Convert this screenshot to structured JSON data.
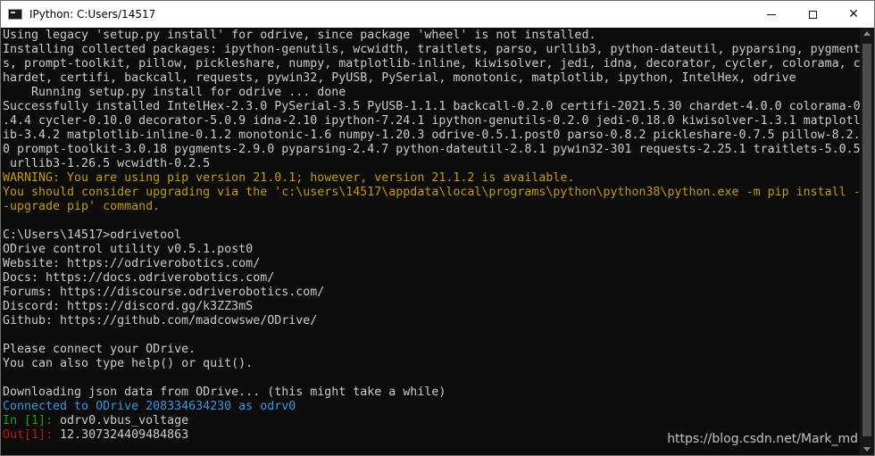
{
  "window": {
    "title": "IPython: C:Users/14517",
    "app_icon": "terminal-icon"
  },
  "controls": {
    "minimize": "minimize-icon",
    "maximize": "maximize-icon",
    "close_label": "✕"
  },
  "terminal": {
    "lines": [
      {
        "text": "Using legacy 'setup.py install' for odrive, since package 'wheel' is not installed.",
        "style": "normal"
      },
      {
        "text": "Installing collected packages: ipython-genutils, wcwidth, traitlets, parso, urllib3, python-dateutil, pyparsing, pygment",
        "style": "normal"
      },
      {
        "text": "s, prompt-toolkit, pillow, pickleshare, numpy, matplotlib-inline, kiwisolver, jedi, idna, decorator, cycler, colorama, c",
        "style": "normal"
      },
      {
        "text": "hardet, certifi, backcall, requests, pywin32, PyUSB, PySerial, monotonic, matplotlib, ipython, IntelHex, odrive",
        "style": "normal"
      },
      {
        "text": "    Running setup.py install for odrive ... done",
        "style": "normal"
      },
      {
        "text": "Successfully installed IntelHex-2.3.0 PySerial-3.5 PyUSB-1.1.1 backcall-0.2.0 certifi-2021.5.30 chardet-4.0.0 colorama-0",
        "style": "normal"
      },
      {
        "text": ".4.4 cycler-0.10.0 decorator-5.0.9 idna-2.10 ipython-7.24.1 ipython-genutils-0.2.0 jedi-0.18.0 kiwisolver-1.3.1 matplotl",
        "style": "normal"
      },
      {
        "text": "ib-3.4.2 matplotlib-inline-0.1.2 monotonic-1.6 numpy-1.20.3 odrive-0.5.1.post0 parso-0.8.2 pickleshare-0.7.5 pillow-8.2.",
        "style": "normal"
      },
      {
        "text": "0 prompt-toolkit-3.0.18 pygments-2.9.0 pyparsing-2.4.7 python-dateutil-2.8.1 pywin32-301 requests-2.25.1 traitlets-5.0.5",
        "style": "normal"
      },
      {
        "text": " urllib3-1.26.5 wcwidth-0.2.5",
        "style": "normal"
      },
      {
        "text": "WARNING: You are using pip version 21.0.1; however, version 21.1.2 is available.",
        "style": "warn"
      },
      {
        "text": "You should consider upgrading via the 'c:\\users\\14517\\appdata\\local\\programs\\python\\python38\\python.exe -m pip install -",
        "style": "warn"
      },
      {
        "text": "-upgrade pip' command.",
        "style": "warn"
      },
      {
        "text": "",
        "style": "normal"
      },
      {
        "text": "C:\\Users\\14517>odrivetool",
        "style": "normal"
      },
      {
        "text": "ODrive control utility v0.5.1.post0",
        "style": "normal"
      },
      {
        "text": "Website: https://odriverobotics.com/",
        "style": "normal"
      },
      {
        "text": "Docs: https://docs.odriverobotics.com/",
        "style": "normal"
      },
      {
        "text": "Forums: https://discourse.odriverobotics.com/",
        "style": "normal"
      },
      {
        "text": "Discord: https://discord.gg/k3ZZ3mS",
        "style": "normal"
      },
      {
        "text": "Github: https://github.com/madcowswe/ODrive/",
        "style": "normal"
      },
      {
        "text": "",
        "style": "normal"
      },
      {
        "text": "Please connect your ODrive.",
        "style": "normal"
      },
      {
        "text": "You can also type help() or quit().",
        "style": "normal"
      },
      {
        "text": "",
        "style": "normal"
      },
      {
        "text": "Downloading json data from ODrive... (this might take a while)",
        "style": "normal"
      },
      {
        "text": "Connected to ODrive 208334634230 as odrv0",
        "style": "conn"
      }
    ],
    "prompt_in": {
      "label": "In [1]:",
      "command": " odrv0.vbus_voltage"
    },
    "prompt_out": {
      "label": "Out[1]:",
      "value": " 12.307324409484863"
    }
  },
  "watermark": "https://blog.csdn.net/Mark_md"
}
